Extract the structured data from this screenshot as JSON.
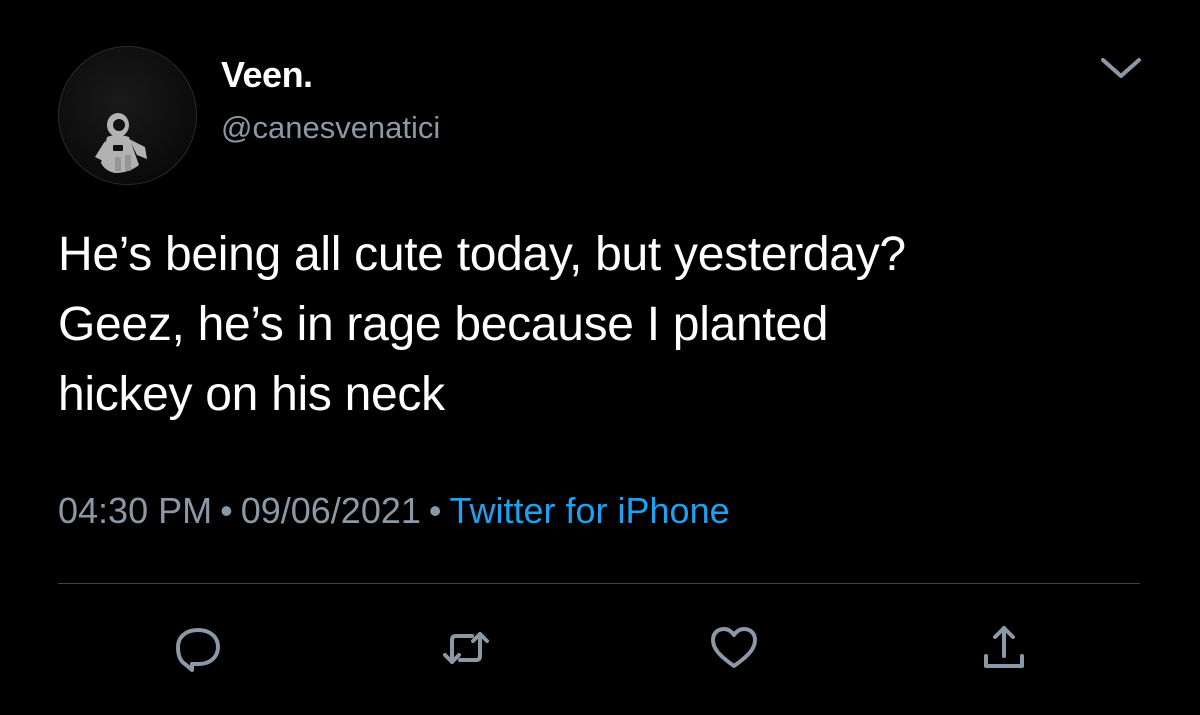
{
  "user": {
    "display_name": "Veen.",
    "handle": "@canesvenatici"
  },
  "tweet": {
    "lines": [
      "He’s being all cute today, but yesterday?",
      "Geez, he’s in rage because I planted",
      "hickey on his neck"
    ],
    "time": "04:30 PM",
    "separator": "•",
    "date": "09/06/2021",
    "source": "Twitter for iPhone"
  },
  "actions": [
    {
      "icon": "reply-icon"
    },
    {
      "icon": "retweet-icon"
    },
    {
      "icon": "like-icon"
    },
    {
      "icon": "share-icon"
    }
  ],
  "colors": {
    "background": "#000000",
    "text": "#ffffff",
    "secondary_text": "#8b98a5",
    "link": "#1da1f2",
    "icon": "#8b98a5",
    "divider": "#3d4248"
  }
}
